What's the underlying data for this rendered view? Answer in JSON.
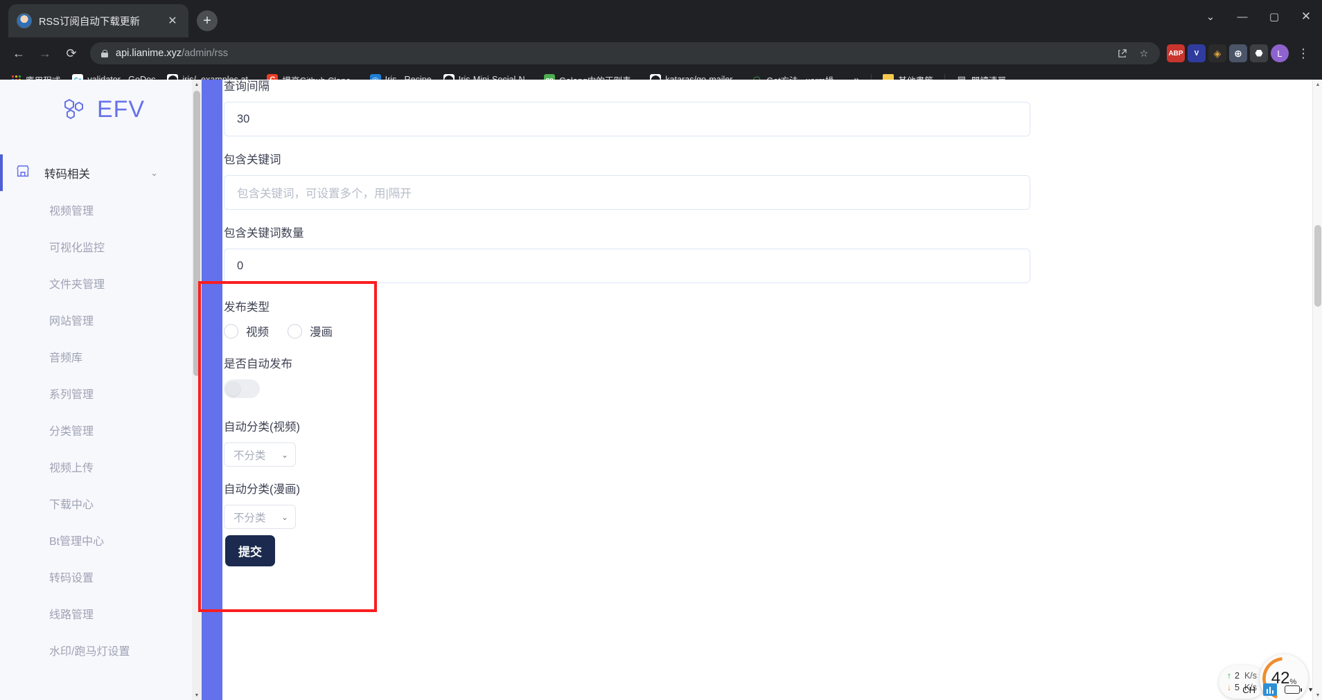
{
  "browser": {
    "tab": {
      "title": "RSS订阅自动下载更新",
      "favicon": "user-avatar-favicon",
      "close_icon": "✕"
    },
    "new_tab_icon": "+",
    "window_controls": [
      "chevron-down-icon",
      "minimize-icon",
      "maximize-icon",
      "close-icon"
    ],
    "nav": {
      "back_icon": "←",
      "forward_icon": "→",
      "reload_icon": "⟳"
    },
    "omnibox": {
      "lock_icon": "lock-icon",
      "url_host": "api.lianime.xyz",
      "url_path": "/admin/rss",
      "share_icon": "↥",
      "bookmark_icon": "☆"
    },
    "extensions": [
      {
        "name": "adblock-plus",
        "label": "ABP",
        "color": "#c9352e"
      },
      {
        "name": "vimium",
        "label": "V",
        "color": "#3f51b5"
      },
      {
        "name": "tampermonkey",
        "label": "TM",
        "color": "#2b2b2b"
      },
      {
        "name": "globe-extension",
        "label": "⊕",
        "color": "#4a5568"
      },
      {
        "name": "puzzle-extensions",
        "label": "🧩",
        "color": "#3c4043"
      }
    ],
    "profile": {
      "initial": "L",
      "color": "#8e63ce"
    },
    "menu_icon": "⋮",
    "bookmarks": {
      "apps_label": "應用程式",
      "items": [
        {
          "label": "validator - GoDoc",
          "icon": "Go",
          "icon_bg": "#ffffff",
          "icon_color": "#00a0d2"
        },
        {
          "label": "iris/_examples at...",
          "icon": "github-icon",
          "icon_bg": "#ffffff",
          "icon_color": "#1b1f23"
        },
        {
          "label": "提高Github Clone...",
          "icon": "C",
          "icon_bg": "#ee3d26",
          "icon_color": "#ffffff"
        },
        {
          "label": "Iris - Recipe",
          "icon": "iris-icon",
          "icon_bg": "#1f7fd4",
          "icon_color": "#ffffff"
        },
        {
          "label": "Iris-Mini-Social-N...",
          "icon": "github-icon",
          "icon_bg": "#ffffff",
          "icon_color": "#1b1f23"
        },
        {
          "label": "Golang中的正则表...",
          "icon": "go",
          "icon_bg": "#4caf50",
          "icon_color": "#ffffff"
        },
        {
          "label": "kataras/go-mailer...",
          "icon": "github-icon",
          "icon_bg": "#ffffff",
          "icon_color": "#1b1f23"
        },
        {
          "label": "Get方法 · xorm操...",
          "icon": "xorm-icon",
          "icon_bg": "#1b8a3f",
          "icon_color": "#ffffff"
        }
      ],
      "overflow_icon": "»",
      "other_bookmarks": "其他書籤",
      "reading_list": "閱讀清單"
    }
  },
  "sidebar": {
    "brand": {
      "name": "EFV",
      "logo_icon": "hexagon-cluster-icon",
      "color": "#6673e8"
    },
    "group": {
      "label": "转码相关",
      "icon": "store-icon",
      "chevron": "chevron-down-icon",
      "active": true
    },
    "items": [
      {
        "label": "视频管理"
      },
      {
        "label": "可视化监控"
      },
      {
        "label": "文件夹管理"
      },
      {
        "label": "网站管理"
      },
      {
        "label": "音频库"
      },
      {
        "label": "系列管理"
      },
      {
        "label": "分类管理"
      },
      {
        "label": "视频上传"
      },
      {
        "label": "下载中心"
      },
      {
        "label": "Bt管理中心"
      },
      {
        "label": "转码设置"
      },
      {
        "label": "线路管理"
      },
      {
        "label": "水印/跑马灯设置"
      }
    ]
  },
  "form": {
    "interval": {
      "label": "查询间隔",
      "value": "30"
    },
    "keywords": {
      "label": "包含关键词",
      "value": "",
      "placeholder": "包含关键词，可设置多个，用|隔开"
    },
    "keyword_count": {
      "label": "包含关键词数量",
      "value": "0"
    },
    "publish_type": {
      "label": "发布类型",
      "options": [
        {
          "label": "视频",
          "checked": false
        },
        {
          "label": "漫画",
          "checked": false
        }
      ]
    },
    "auto_publish": {
      "label": "是否自动发布",
      "on": false
    },
    "auto_category_video": {
      "label": "自动分类(视频)",
      "value": "不分类",
      "chevron": "chevron-down-icon"
    },
    "auto_category_comic": {
      "label": "自动分类(漫画)",
      "value": "不分类",
      "chevron": "chevron-down-icon"
    },
    "submit": {
      "label": "提交"
    },
    "annotation_color": "#fb1d20"
  },
  "net_widget": {
    "upload": {
      "arrow": "↑",
      "value": "2",
      "unit": "K/s"
    },
    "download": {
      "arrow": "↓",
      "value": "5",
      "unit": "K/s"
    },
    "gauge": {
      "value": "42",
      "suffix": "%"
    }
  },
  "tray": {
    "ime": "CH"
  }
}
